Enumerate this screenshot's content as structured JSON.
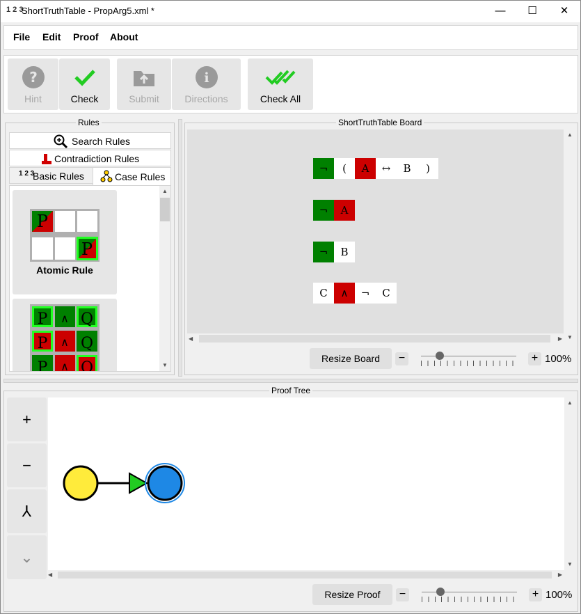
{
  "window": {
    "app_icon": "1 2 3",
    "title": "ShortTruthTable - PropArg5.xml *",
    "minimize": "—",
    "maximize": "☐",
    "close": "✕"
  },
  "menu": [
    "File",
    "Edit",
    "Proof",
    "About"
  ],
  "toolbar": {
    "hint": "Hint",
    "check": "Check",
    "submit": "Submit",
    "directions": "Directions",
    "check_all": "Check All"
  },
  "rules_panel": {
    "title": "Rules",
    "search": "Search Rules",
    "contradiction": "Contradiction Rules",
    "basic": "Basic Rules",
    "case": "Case Rules",
    "basic_icon": "1 2 3",
    "cards": [
      {
        "label": "Atomic Rule",
        "grid": [
          "P",
          "",
          "",
          "",
          "",
          "P"
        ]
      },
      {
        "label": "",
        "grid": [
          "P",
          "∧",
          "Q",
          "P",
          "∧",
          "Q",
          "P",
          "∧",
          "Q"
        ]
      }
    ]
  },
  "board": {
    "title": "ShortTruthTable Board",
    "rows": [
      [
        {
          "text": "¬",
          "color": "green"
        },
        {
          "text": "(",
          "color": "white"
        },
        {
          "text": "A",
          "color": "red"
        },
        {
          "text": "↔",
          "color": "white"
        },
        {
          "text": "B",
          "color": "white"
        },
        {
          "text": ")",
          "color": "white"
        }
      ],
      [
        {
          "text": "¬",
          "color": "green"
        },
        {
          "text": "A",
          "color": "red"
        }
      ],
      [
        {
          "text": "¬",
          "color": "green"
        },
        {
          "text": "B",
          "color": "white"
        }
      ],
      [
        {
          "text": "C",
          "color": "white"
        },
        {
          "text": "∧",
          "color": "red"
        },
        {
          "text": "¬",
          "color": "white"
        },
        {
          "text": "C",
          "color": "white"
        }
      ]
    ],
    "resize_label": "Resize Board",
    "zoom_minus": "−",
    "zoom_plus": "+",
    "zoom": "100%",
    "zoom_level": 0.2
  },
  "proof_tree": {
    "title": "Proof Tree",
    "zoom_in": "+",
    "zoom_out": "−",
    "merge": "⅄",
    "collapse": "⌄",
    "resize_label": "Resize Proof",
    "zoom_minus": "−",
    "zoom_plus": "+",
    "zoom": "100%",
    "zoom_level": 0.2,
    "colors": {
      "root": "#ffeb3b",
      "arrow": "#22cc22",
      "node": "#1e88e5"
    }
  },
  "colors": {
    "green": "#008000",
    "red": "#cc0000",
    "highlight": "#22ff22"
  }
}
